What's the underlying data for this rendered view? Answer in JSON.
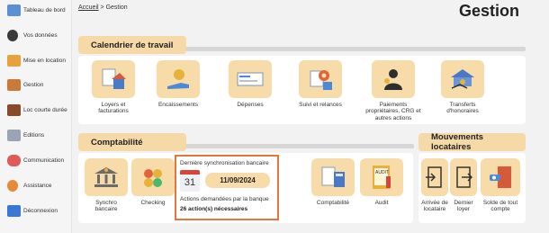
{
  "sidebar": {
    "items": [
      {
        "label": "Tableau de bord",
        "icon": "dashboard-icon",
        "color": "#5b8fd6"
      },
      {
        "label": "Vos données",
        "icon": "user-icon",
        "color": "#3a3a3a"
      },
      {
        "label": "Mise en location",
        "icon": "key-location-icon",
        "color": "#e6a23c"
      },
      {
        "label": "Gestion",
        "icon": "management-icon",
        "color": "#c97a3a"
      },
      {
        "label": "Loc courte durée",
        "icon": "suitcase-icon",
        "color": "#8a4a2a"
      },
      {
        "label": "Editions",
        "icon": "documents-icon",
        "color": "#9aa4b2"
      },
      {
        "label": "Communication",
        "icon": "chat-icon",
        "color": "#e05a5a"
      },
      {
        "label": "Assistance",
        "icon": "support-icon",
        "color": "#e58a3a"
      },
      {
        "label": "Déconnexion",
        "icon": "logout-icon",
        "color": "#3a78d6"
      }
    ]
  },
  "breadcrumb": {
    "home": "Accueil",
    "separator": ">",
    "current": "Gestion"
  },
  "page_title": "Gestion",
  "sections": {
    "travail": {
      "title": "Calendrier de travail",
      "tiles": [
        {
          "label": "Loyers et facturations",
          "icon": "rent-house-icon"
        },
        {
          "label": "Encaissements",
          "icon": "coins-hand-icon"
        },
        {
          "label": "Dépenses",
          "icon": "cheque-icon"
        },
        {
          "label": "Suivi et relances",
          "icon": "follow-up-gear-icon"
        },
        {
          "label": "Paiements propriétaires, CRG et autres actions",
          "icon": "owner-payment-icon"
        },
        {
          "label": "Transferts d'honoraires",
          "icon": "fees-transfer-icon"
        }
      ]
    },
    "comptabilite": {
      "title": "Comptabilité",
      "tiles": [
        {
          "label": "Synchro bancaire",
          "icon": "bank-sync-icon"
        },
        {
          "label": "Checking",
          "icon": "checking-coins-icon"
        },
        {
          "label": "Comptabilité",
          "icon": "accounting-calculator-icon"
        },
        {
          "label": "Audit",
          "icon": "audit-folder-icon"
        }
      ]
    },
    "mouvements": {
      "title": "Mouvements locataires",
      "tiles": [
        {
          "label": "Arrivée de locataire",
          "icon": "tenant-arrival-icon"
        },
        {
          "label": "Dernier loyer",
          "icon": "last-rent-icon"
        },
        {
          "label": "Solde de tout compte",
          "icon": "final-settlement-icon"
        }
      ]
    }
  },
  "sync": {
    "title": "Dernière synchronisation bancaire",
    "calendar_day": "31",
    "date": "11/09/2024",
    "actions_label": "Actions demandées par la banque",
    "actions_count": "26 action(s) nécessaires",
    "border_color": "#e8753a"
  },
  "colors": {
    "accent": "#f7dcaa",
    "highlight": "#e8753a"
  }
}
